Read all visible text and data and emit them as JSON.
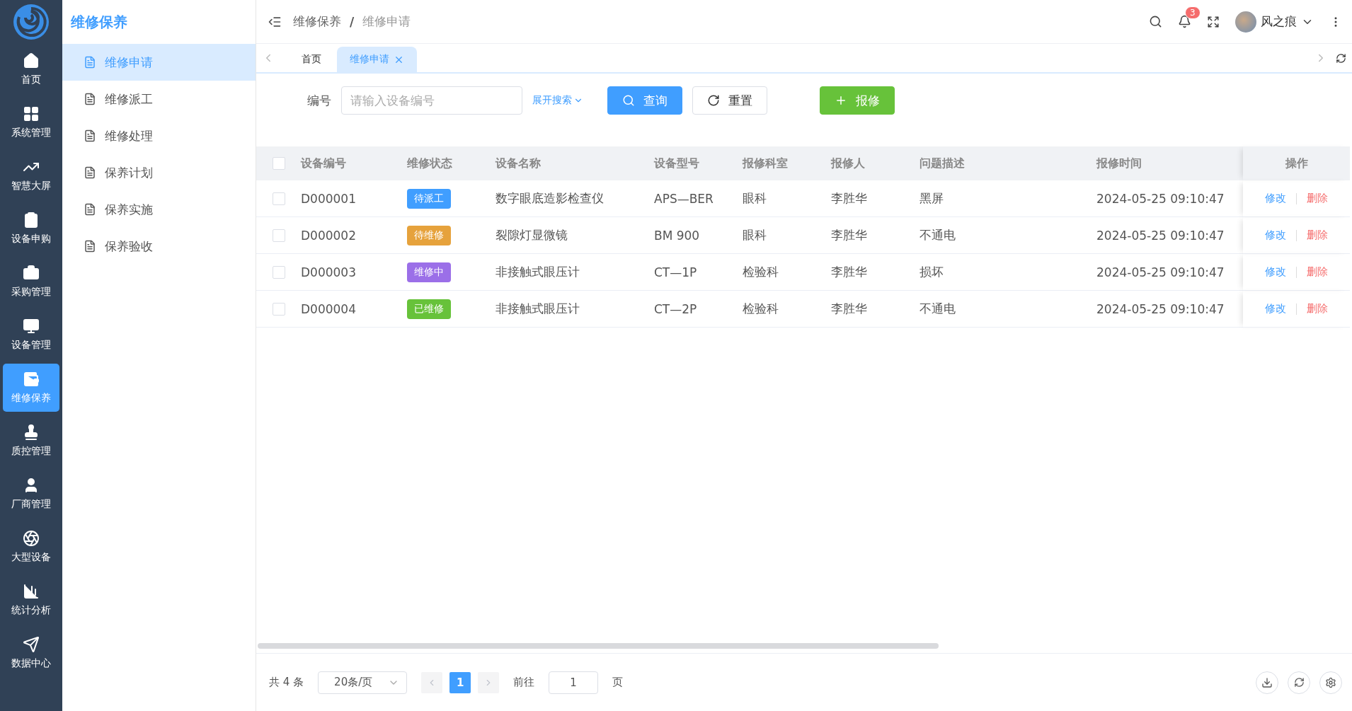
{
  "nav_rail": {
    "items": [
      {
        "label": "首页",
        "selected": false
      },
      {
        "label": "系统管理",
        "selected": false
      },
      {
        "label": "智慧大屏",
        "selected": false
      },
      {
        "label": "设备申购",
        "selected": false
      },
      {
        "label": "采购管理",
        "selected": false
      },
      {
        "label": "设备管理",
        "selected": false
      },
      {
        "label": "维修保养",
        "selected": true
      },
      {
        "label": "质控管理",
        "selected": false
      },
      {
        "label": "厂商管理",
        "selected": false
      },
      {
        "label": "大型设备",
        "selected": false
      },
      {
        "label": "统计分析",
        "selected": false
      },
      {
        "label": "数据中心",
        "selected": false
      }
    ]
  },
  "submenu": {
    "title": "维修保养",
    "items": [
      {
        "label": "维修申请",
        "selected": true
      },
      {
        "label": "维修派工",
        "selected": false
      },
      {
        "label": "维修处理",
        "selected": false
      },
      {
        "label": "保养计划",
        "selected": false
      },
      {
        "label": "保养实施",
        "selected": false
      },
      {
        "label": "保养验收",
        "selected": false
      }
    ]
  },
  "header": {
    "breadcrumb": [
      "维修保养",
      "维修申请"
    ],
    "separator": "/",
    "notifications": "3",
    "user": "风之痕"
  },
  "tabs": [
    {
      "label": "首页",
      "selected": false
    },
    {
      "label": "维修申请",
      "selected": true
    }
  ],
  "search": {
    "label": "编号",
    "placeholder": "请输入设备编号",
    "expand": "展开搜索",
    "buttons": [
      {
        "label": "查询",
        "kind": "primary"
      },
      {
        "label": "重置",
        "kind": "default"
      },
      {
        "label": "报修",
        "kind": "success"
      }
    ]
  },
  "table": {
    "select_all_checked": false,
    "columns": [
      "设备编号",
      "维修状态",
      "设备名称",
      "设备型号",
      "报修科室",
      "报修人",
      "问题描述",
      "报修时间",
      "操作"
    ],
    "rows": [
      {
        "checked": false,
        "code": "D000001",
        "status": {
          "label": "待派工",
          "color": "#409eff"
        },
        "name": "数字眼底造影检查仪",
        "model": "APS—BER",
        "dept": "眼科",
        "person": "李胜华",
        "issue": "黑屏",
        "time": "2024-05-25 09:10:47",
        "actions": [
          "修改",
          "删除"
        ]
      },
      {
        "checked": false,
        "code": "D000002",
        "status": {
          "label": "待维修",
          "color": "#e6a23c"
        },
        "name": "裂隙灯显微镜",
        "model": "BM 900",
        "dept": "眼科",
        "person": "李胜华",
        "issue": "不通电",
        "time": "2024-05-25 09:10:47",
        "actions": [
          "修改",
          "删除"
        ]
      },
      {
        "checked": false,
        "code": "D000003",
        "status": {
          "label": "维修中",
          "color": "#9b6fe8"
        },
        "name": "非接触式眼压计",
        "model": "CT—1P",
        "dept": "检验科",
        "person": "李胜华",
        "issue": "损坏",
        "time": "2024-05-25 09:10:47",
        "actions": [
          "修改",
          "删除"
        ]
      },
      {
        "checked": false,
        "code": "D000004",
        "status": {
          "label": "已维修",
          "color": "#67c23a"
        },
        "name": "非接触式眼压计",
        "model": "CT—2P",
        "dept": "检验科",
        "person": "李胜华",
        "issue": "不通电",
        "time": "2024-05-25 09:10:47",
        "actions": [
          "修改",
          "删除"
        ]
      }
    ]
  },
  "pagination": {
    "total": "共 4 条",
    "page_size": "20条/页",
    "pages": [
      {
        "label": "1",
        "selected": true
      }
    ],
    "goto_label": "前往",
    "goto_value": "1",
    "page_suffix": "页"
  }
}
